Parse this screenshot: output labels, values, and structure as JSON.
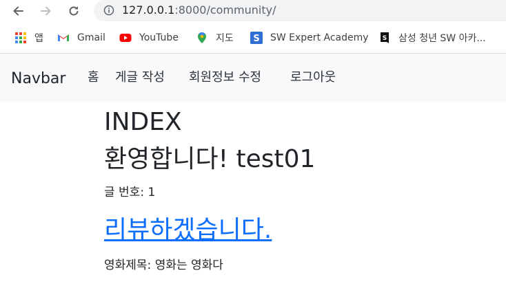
{
  "browser": {
    "url_host": "127.0.0.1",
    "url_rest": ":8000/community/",
    "bookmarks": [
      {
        "label": "앱",
        "icon": "apps-grid-icon"
      },
      {
        "label": "Gmail",
        "icon": "gmail-icon"
      },
      {
        "label": "YouTube",
        "icon": "youtube-icon"
      },
      {
        "label": "지도",
        "icon": "maps-pin-icon"
      },
      {
        "label": "SW Expert Academy",
        "icon": "swea-icon"
      },
      {
        "label": "삼성 청년 SW 아카...",
        "icon": "ssafy-icon"
      }
    ]
  },
  "navbar": {
    "brand": "Navbar",
    "links": [
      "홈",
      "게글 작성",
      "회원정보 수정",
      "로그아웃"
    ]
  },
  "main": {
    "heading": "INDEX",
    "welcome": "환영합니다! test01",
    "post_number": "글 번호: 1",
    "post_title": "리뷰하겠습니다.",
    "movie_title": "영화제목: 영화는 영화다"
  },
  "colors": {
    "link": "#0d6efd",
    "navbar_bg": "#f8f9fa"
  }
}
